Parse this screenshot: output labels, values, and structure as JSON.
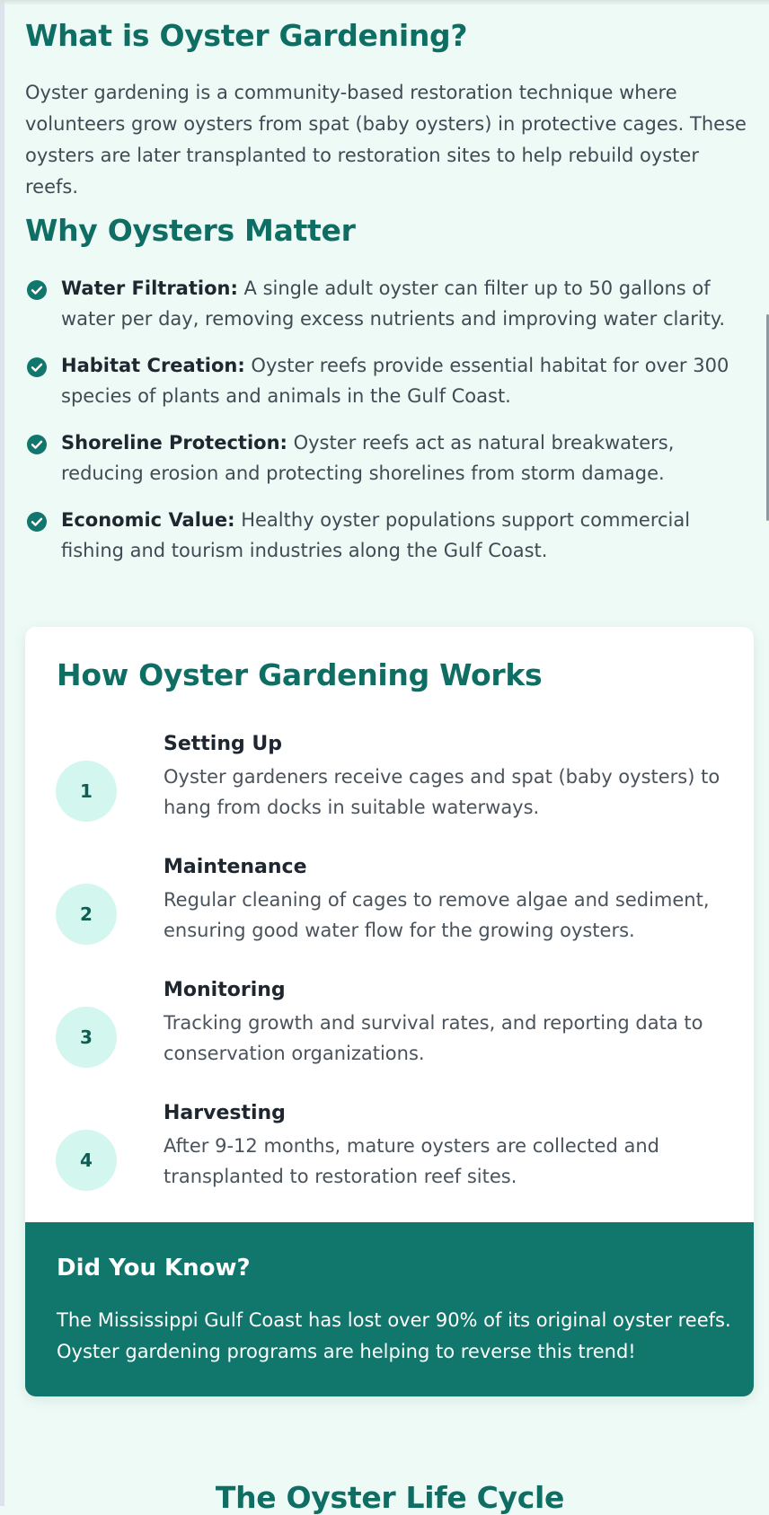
{
  "what_section": {
    "title": "What is Oyster Gardening?",
    "text": "Oyster gardening is a community-based restoration technique where volunteers grow oysters from spat (baby oysters) in protective cages. These oysters are later transplanted to restoration sites to help rebuild oyster reefs."
  },
  "why_section": {
    "title": "Why Oysters Matter",
    "items": [
      {
        "icon": "check-circle-icon",
        "label": "Water Filtration:",
        "text": " A single adult oyster can filter up to 50 gallons of water per day, removing excess nutrients and improving water clarity."
      },
      {
        "icon": "check-circle-icon",
        "label": "Habitat Creation:",
        "text": " Oyster reefs provide essential habitat for over 300 species of plants and animals in the Gulf Coast."
      },
      {
        "icon": "check-circle-icon",
        "label": "Shoreline Protection:",
        "text": " Oyster reefs act as natural breakwaters, reducing erosion and protecting shorelines from storm damage."
      },
      {
        "icon": "check-circle-icon",
        "label": "Economic Value:",
        "text": " Healthy oyster populations support commercial fishing and tourism industries along the Gulf Coast."
      }
    ]
  },
  "how_section": {
    "title": "How Oyster Gardening Works",
    "steps": [
      {
        "number": "1",
        "title": "Setting Up",
        "text": "Oyster gardeners receive cages and spat (baby oysters) to hang from docks in suitable waterways."
      },
      {
        "number": "2",
        "title": "Maintenance",
        "text": "Regular cleaning of cages to remove algae and sediment, ensuring good water flow for the growing oysters."
      },
      {
        "number": "3",
        "title": "Monitoring",
        "text": "Tracking growth and survival rates, and reporting data to conservation organizations."
      },
      {
        "number": "4",
        "title": "Harvesting",
        "text": "After 9-12 months, mature oysters are collected and transplanted to restoration reef sites."
      }
    ]
  },
  "did_you_know": {
    "title": "Did You Know?",
    "text": "The Mississippi Gulf Coast has lost over 90% of its original oyster reefs. Oyster gardening programs are helping to reverse this trend!"
  },
  "lifecycle_section": {
    "title": "The Oyster Life Cycle"
  },
  "colors": {
    "accent": "#0f6e63",
    "check": "#11766b",
    "step_circle": "#d3f7ee",
    "callout_bg": "#11766b",
    "page_bg": "#eefaf6"
  }
}
